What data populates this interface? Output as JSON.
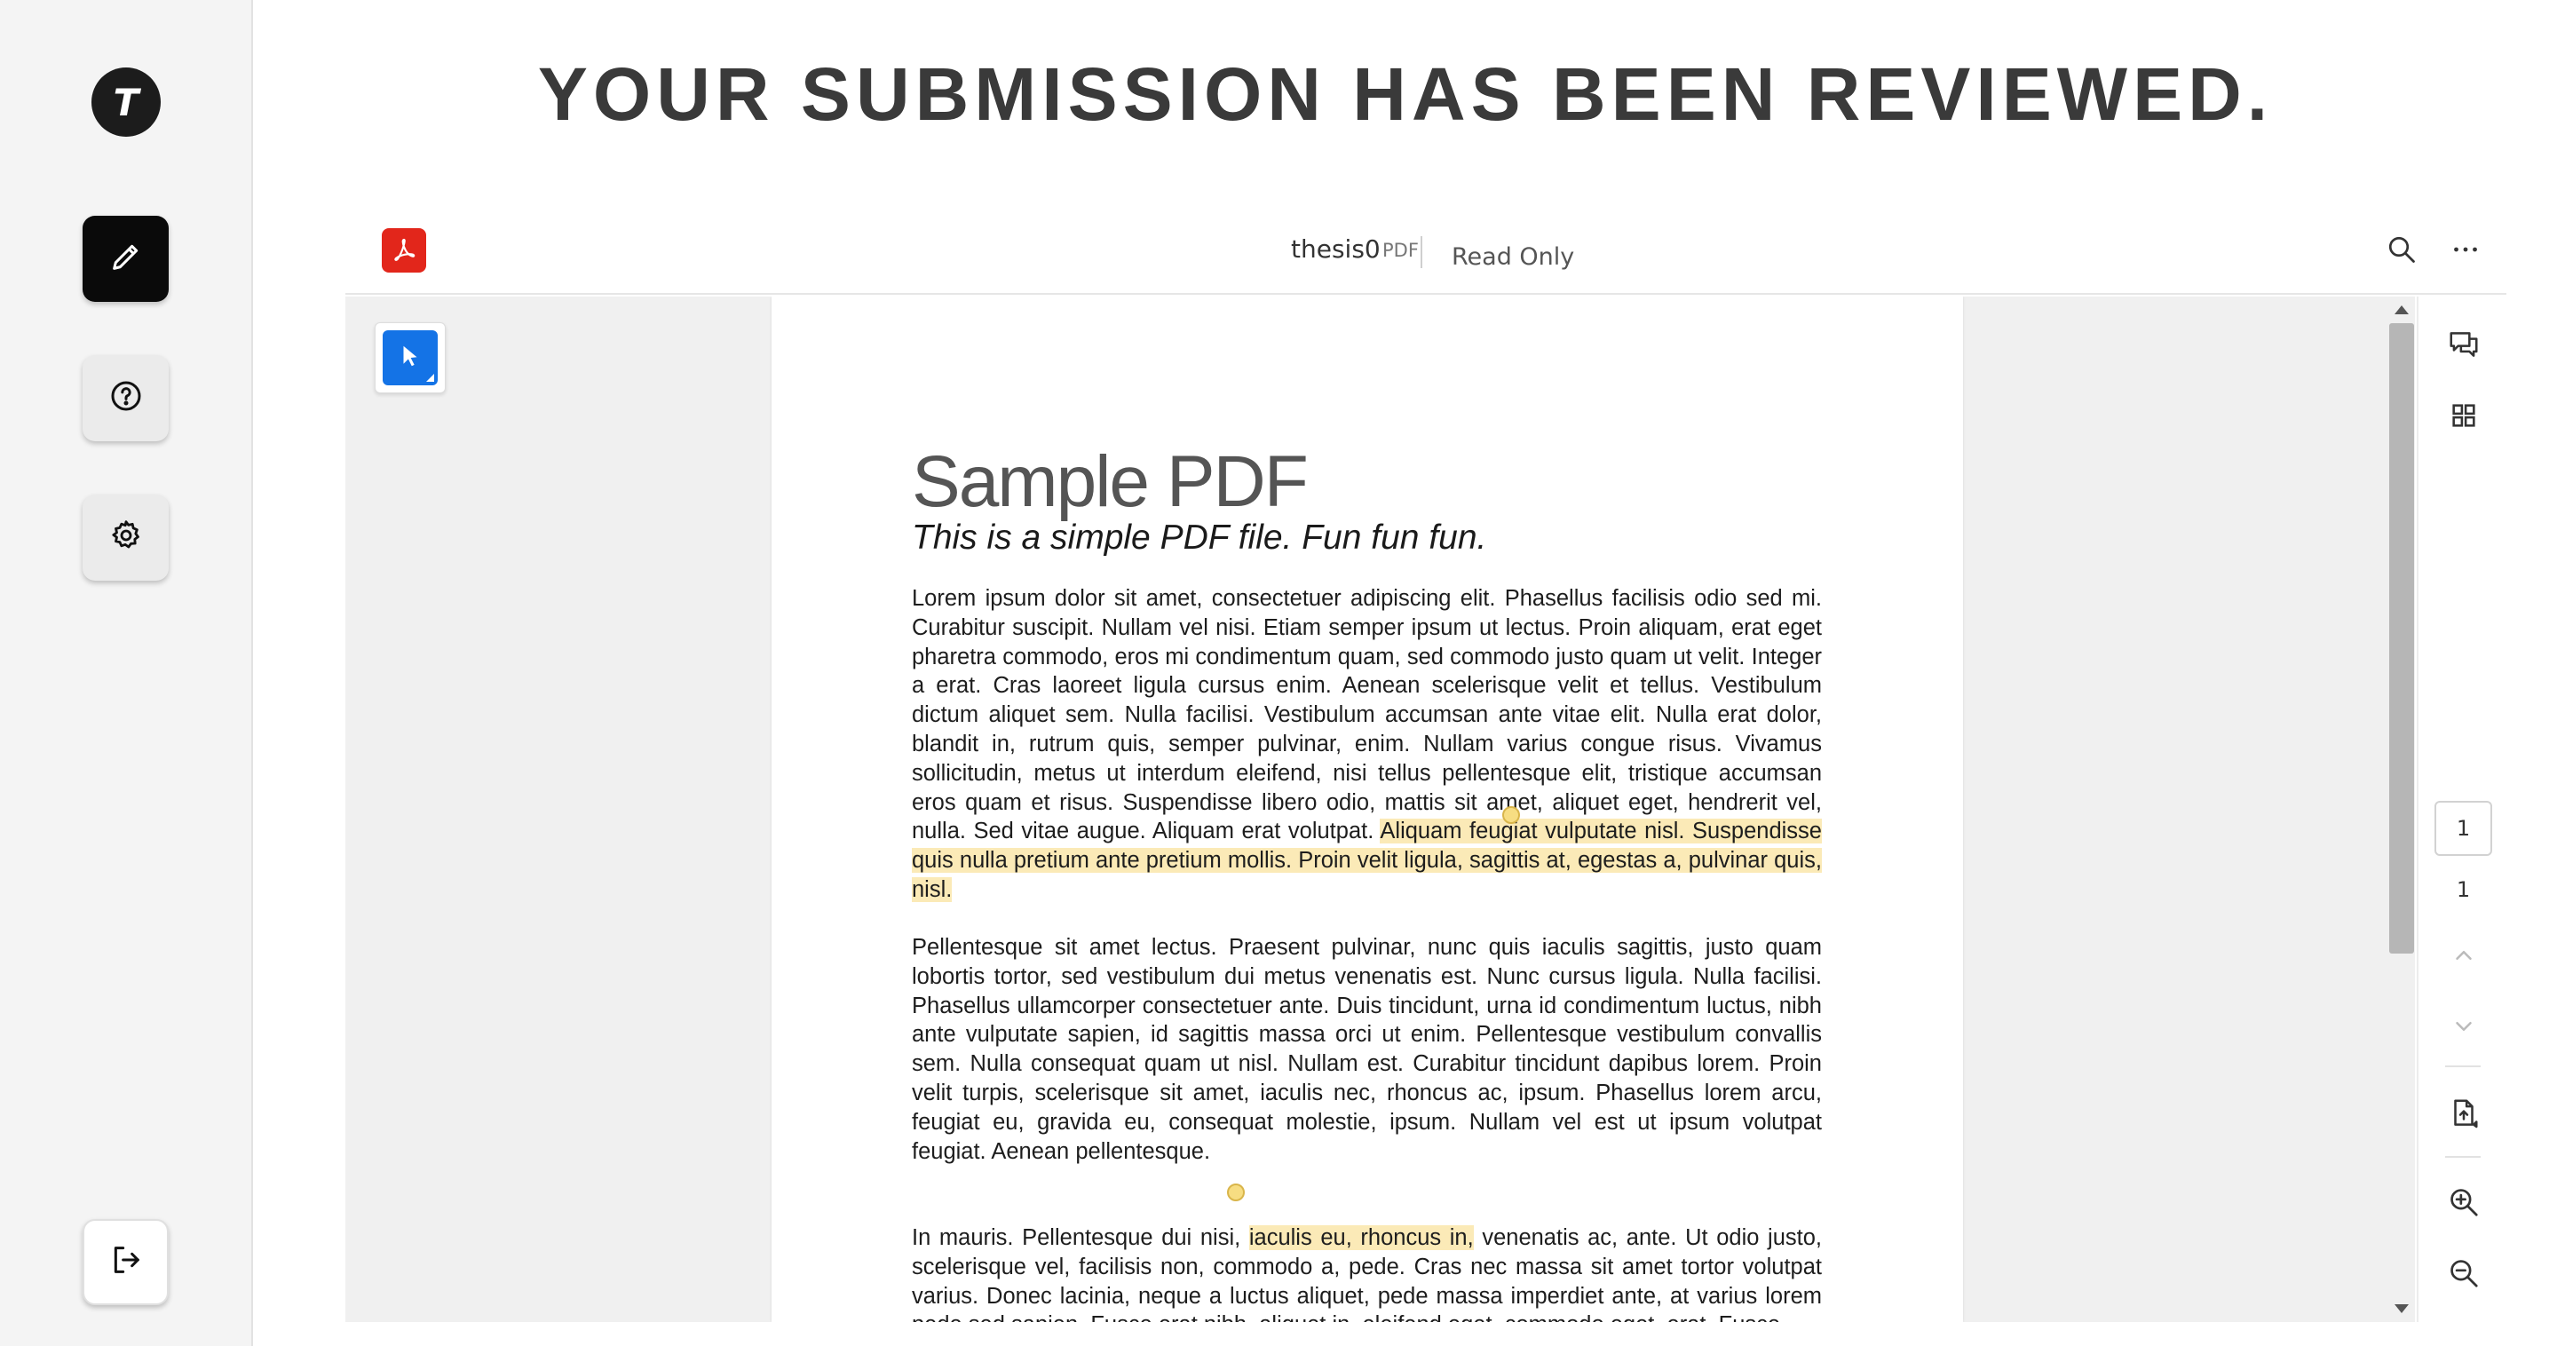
{
  "sidebar": {
    "logo_letter": "T",
    "buttons": [
      {
        "name": "edit",
        "icon": "pencil-icon",
        "active": true
      },
      {
        "name": "help",
        "icon": "question-circle-icon",
        "active": false
      },
      {
        "name": "settings",
        "icon": "gear-icon",
        "active": false
      }
    ],
    "logout_icon": "logout-icon"
  },
  "heading": "YOUR SUBMISSION HAS BEEN REVIEWED.",
  "viewer": {
    "app_icon": "acrobat-icon",
    "file_name": "thesis0",
    "file_type": "PDF",
    "mode": "Read Only",
    "top_icons": [
      "search-icon",
      "more-icon"
    ],
    "tool_icon": "select-pointer-icon",
    "accent_color": "#1473e6",
    "right_icons": [
      "comment-icon",
      "thumbnails-icon",
      "page-doc-icon",
      "zoom-in-icon",
      "zoom-out-icon"
    ],
    "page_current": "1",
    "page_total": "1"
  },
  "document": {
    "title": "Sample PDF",
    "subtitle": "This is a simple PDF file. Fun fun fun.",
    "para1_a": "Lorem ipsum dolor sit amet, consectetuer adipiscing elit. Phasellus facilisis odio sed mi. Curabitur suscipit. Nullam vel nisi. Etiam semper ipsum ut lectus. Proin aliquam, erat eget pharetra commodo, eros mi condimentum quam, sed commodo justo quam ut velit. Integer a erat. Cras laoreet ligula cursus enim. Aenean scelerisque velit et tellus. Vestibulum dictum aliquet sem. Nulla facilisi. Vestibulum accumsan ante vitae elit. Nulla erat dolor, blandit in, rutrum quis, semper pulvinar, enim. Nullam varius congue risus. Vivamus sollicitudin, metus ut interdum eleifend, nisi tellus pellentesque elit, tristique accumsan eros quam et risus. Suspendisse libero odio, mattis sit amet, aliquet eget, hendrerit vel, nulla. Sed vitae augue. Aliquam erat volutpat.",
    "para1_hl": "Aliquam feugiat vulputate nisl. Suspendisse quis nulla pretium ante pretium mollis. Proin velit ligula, sagittis at, egestas a, pulvinar quis, nisl.",
    "para2": "Pellentesque sit amet lectus. Praesent pulvinar, nunc quis iaculis sagittis, justo quam lobortis tortor, sed vestibulum dui metus venenatis est. Nunc cursus ligula. Nulla facilisi. Phasellus ullamcorper consectetuer ante. Duis tincidunt, urna id condimentum luctus, nibh ante vulputate sapien, id sagittis massa orci ut enim. Pellentesque vestibulum convallis sem. Nulla consequat quam ut nisl. Nullam est. Curabitur tincidunt dapibus lorem. Proin velit turpis, scelerisque sit amet, iaculis nec, rhoncus ac, ipsum. Phasellus lorem arcu, feugiat eu, gravida eu, consequat molestie, ipsum. Nullam vel est ut ipsum volutpat feugiat. Aenean pellentesque.",
    "para3_a": "In mauris. Pellentesque dui nisi,",
    "para3_hl": "iaculis eu, rhoncus in,",
    "para3_b": "venenatis ac, ante. Ut odio justo, scelerisque vel, facilisis non, commodo a, pede. Cras nec massa sit amet tortor volutpat varius. Donec lacinia, neque a luctus aliquet, pede massa imperdiet ante, at varius lorem pede sed sapien. Fusce erat nibh, aliquet in, eleifend eget, commodo eget, erat. Fusce"
  }
}
